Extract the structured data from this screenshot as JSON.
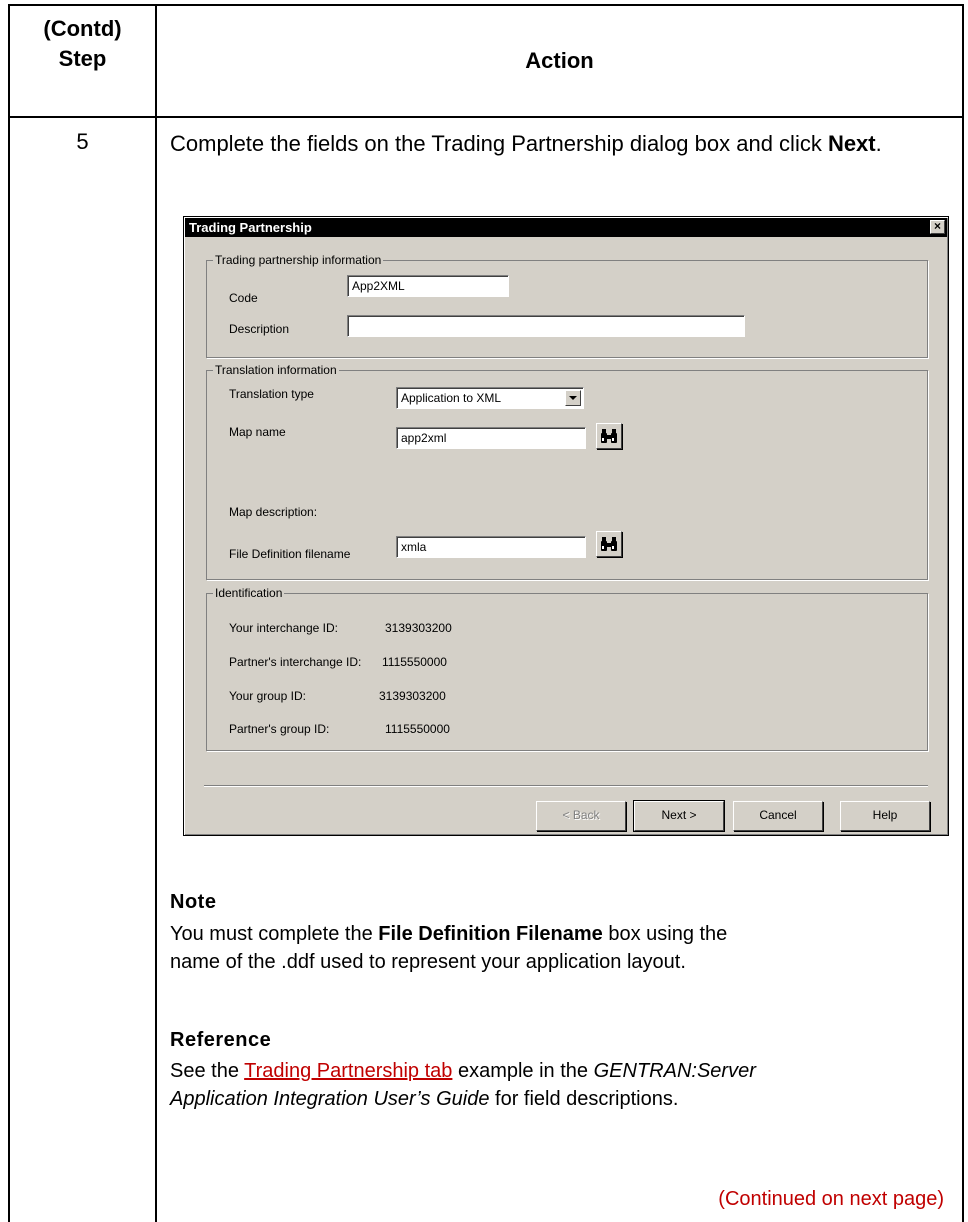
{
  "table": {
    "header_step": "(Contd)\nStep",
    "header_step_line1": "(Contd)",
    "header_step_line2": "Step",
    "header_action": "Action",
    "step_number": "5",
    "instruction_pre": "Complete the fields on the Trading Partnership dialog box and click ",
    "instruction_bold": "Next",
    "instruction_post": "."
  },
  "dialog": {
    "title": "Trading Partnership",
    "close_symbol": "×",
    "tp_group_title": "Trading partnership information",
    "code_label": "Code",
    "code_value": "App2XML",
    "description_label": "Description",
    "description_value": "",
    "translation_group_title": "Translation information",
    "translation_type_label": "Translation type",
    "translation_type_value": "Application to XML",
    "map_name_label": "Map name",
    "map_name_value": "app2xml",
    "map_description_label": "Map description:",
    "file_def_label": "File Definition filename",
    "file_def_value": "xmla",
    "identification_group_title": "Identification",
    "your_interchange_label": "Your interchange ID:",
    "your_interchange_value": "3139303200",
    "partner_interchange_label": "Partner's interchange ID:",
    "partner_interchange_value": "1115550000",
    "your_group_label": "Your group ID:",
    "your_group_value": "3139303200",
    "partner_group_label": "Partner's group ID:",
    "partner_group_value": "1115550000",
    "buttons": {
      "back": "< Back",
      "next": "Next >",
      "cancel": "Cancel",
      "help": "Help"
    }
  },
  "note": {
    "heading": "Note",
    "text_pre": "You must complete the ",
    "text_bold": "File Definition Filename",
    "text_post": " box using the name of the .ddf used to represent your application layout."
  },
  "reference": {
    "heading": "Reference",
    "text_pre": "See the ",
    "link_text": "Trading Partnership tab",
    "text_mid": " example in the ",
    "italic_text": "GENTRAN:Server Application Integration User’s Guide",
    "text_post": " for field descriptions."
  },
  "continued": "(Continued on next page)",
  "colors": {
    "dialog_bg": "#d4d0c8",
    "link": "#c00000",
    "titlebar": "#000000"
  }
}
